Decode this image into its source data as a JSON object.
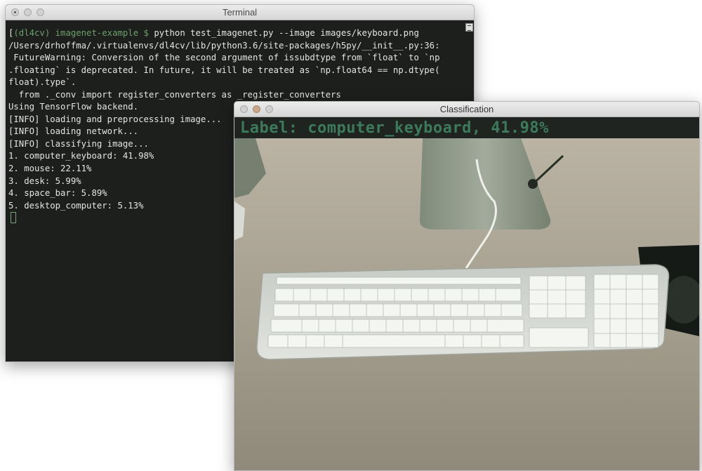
{
  "terminal": {
    "title": "Terminal",
    "prompt_env": "(dl4cv)",
    "prompt_dir": "imagenet-example $",
    "command": "python test_imagenet.py --image images/keyboard.png",
    "lines": [
      "/Users/drhoffma/.virtualenvs/dl4cv/lib/python3.6/site-packages/h5py/__init__.py:36:",
      " FutureWarning: Conversion of the second argument of issubdtype from `float` to `np",
      ".floating` is deprecated. In future, it will be treated as `np.float64 == np.dtype(",
      "float).type`.",
      "  from ._conv import register_converters as _register_converters",
      "Using TensorFlow backend.",
      "[INFO] loading and preprocessing image...",
      "[INFO] loading network...",
      "[INFO] classifying image...",
      "1. computer_keyboard: 41.98%",
      "2. mouse: 22.11%",
      "3. desk: 5.99%",
      "4. space_bar: 5.89%",
      "5. desktop_computer: 5.13%"
    ]
  },
  "classification": {
    "title": "Classification",
    "label": "Label: computer_keyboard, 41.98%"
  },
  "colors": {
    "terminal_bg": "#1d1f1d",
    "prompt_green": "#6d9e6c",
    "overlay_green": "#3d7a5c"
  }
}
